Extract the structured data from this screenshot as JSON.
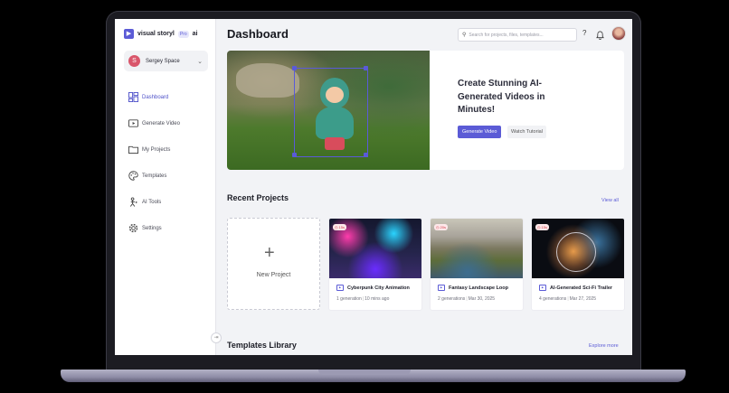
{
  "sidebar": {
    "brand_name": "visual storyl",
    "brand_badge": "Pro",
    "brand_suffix": "ai",
    "user": {
      "initial": "S",
      "name": "Sergey Space"
    },
    "items": [
      {
        "label": "Dashboard",
        "icon": "dashboard-icon",
        "active": true
      },
      {
        "label": "Generate Video",
        "icon": "video-icon"
      },
      {
        "label": "My Projects",
        "icon": "folder-icon"
      },
      {
        "label": "Templates",
        "icon": "palette-icon"
      },
      {
        "label": "AI Tools",
        "icon": "ai-tools-icon"
      },
      {
        "label": "Settings",
        "icon": "gear-icon"
      }
    ]
  },
  "header": {
    "title": "Dashboard",
    "search_placeholder": "Search for projects, files, templates..."
  },
  "hero": {
    "heading": "Create Stunning AI-Generated Videos in Minutes!",
    "primary_button": "Generate Video",
    "secondary_button": "Watch Tutorial"
  },
  "recent": {
    "title": "Recent Projects",
    "view_all": "View all",
    "new_project_label": "New Project",
    "projects": [
      {
        "badge": "15s",
        "title": "Cyberpunk City Animation",
        "meta_count": "1 generation",
        "meta_time": "10 mins ago"
      },
      {
        "badge": "20s",
        "title": "Fantasy Landscape Loop",
        "meta_count": "2 generations",
        "meta_time": "Mar 30, 2025"
      },
      {
        "badge": "15s",
        "title": "AI-Generated Sci-Fi Trailer",
        "meta_count": "4 generations",
        "meta_time": "Mar 27, 2025"
      }
    ]
  },
  "templates": {
    "title": "Templates Library",
    "explore": "Explore more"
  },
  "colors": {
    "accent": "#5b5bd6",
    "badge_text": "#d6404c",
    "avatar": "#d9566b"
  }
}
